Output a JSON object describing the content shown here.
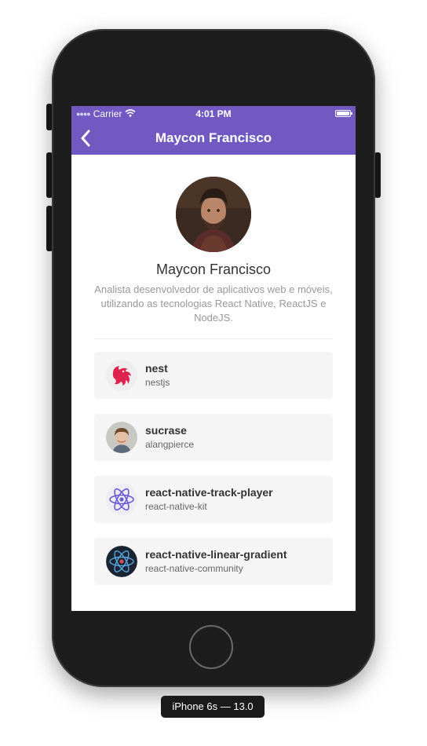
{
  "device": {
    "label": "iPhone 6s — 13.0"
  },
  "status_bar": {
    "carrier": "Carrier",
    "time": "4:01 PM",
    "icons": [
      "signal-dots-icon",
      "wifi-icon",
      "battery-icon"
    ]
  },
  "nav": {
    "title": "Maycon Francisco",
    "back_icon": "chevron-left-icon"
  },
  "profile": {
    "name": "Maycon Francisco",
    "bio": "Analista desenvolvedor de aplicativos web e móveis, utilizando as tecnologias React Native, ReactJS e NodeJS."
  },
  "repos": [
    {
      "title": "nest",
      "author": "nestjs",
      "avatar_icon": "nest-logo-icon"
    },
    {
      "title": "sucrase",
      "author": "alangpierce",
      "avatar_icon": "user-photo-avatar"
    },
    {
      "title": "react-native-track-player",
      "author": "react-native-kit",
      "avatar_icon": "react-atom-purple-icon"
    },
    {
      "title": "react-native-linear-gradient",
      "author": "react-native-community",
      "avatar_icon": "react-atom-dark-icon"
    }
  ],
  "colors": {
    "header": "#7159c1",
    "card": "#f5f5f5",
    "title_text": "#333333",
    "muted_text": "#999999"
  }
}
